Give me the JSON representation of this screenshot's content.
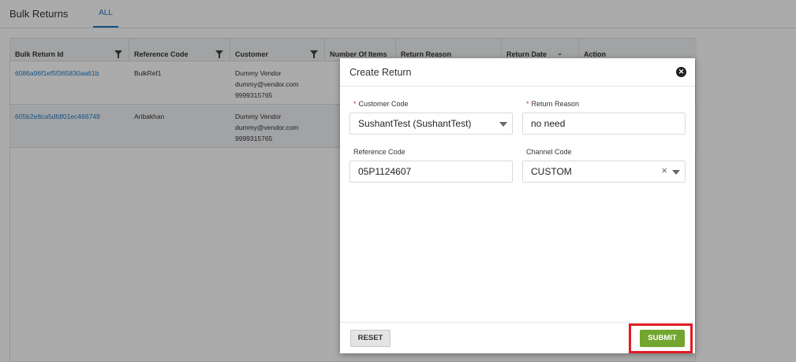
{
  "page": {
    "title": "Bulk Returns",
    "tabs": [
      {
        "label": "ALL",
        "active": true
      }
    ]
  },
  "grid": {
    "columns": [
      "Bulk Return Id",
      "Reference Code",
      "Customer",
      "Number Of Items",
      "Return Reason",
      "Return Date",
      "Action"
    ],
    "rows": [
      {
        "id": "6086a96f1ef5f365830aa61b",
        "reference": "BulkRef1",
        "customer_name": "Dummy Vendor",
        "customer_email": "dummy@vendor.com",
        "customer_phone": "9999315765"
      },
      {
        "id": "605b2e8ca5dfdf01ec466749",
        "reference": "Aribakhan",
        "customer_name": "Dummy Vendor",
        "customer_email": "dummy@vendor.com",
        "customer_phone": "9999315765"
      }
    ]
  },
  "modal": {
    "title": "Create Return",
    "close_icon": "close-icon",
    "fields": {
      "customer_code": {
        "label": "Customer Code",
        "required": true,
        "value": "SushantTest (SushantTest)"
      },
      "return_reason": {
        "label": "Return Reason",
        "required": true,
        "value": "no need"
      },
      "reference_code": {
        "label": "Reference Code",
        "required": false,
        "value": "05P1124607"
      },
      "channel_code": {
        "label": "Channel Code",
        "required": false,
        "value": "CUSTOM"
      }
    },
    "reset_label": "RESET",
    "submit_label": "SUBMIT"
  },
  "colors": {
    "accent_blue": "#1e7ac7",
    "submit_green": "#72a62e",
    "highlight_red": "#e01b24",
    "required_red": "#d9372b"
  }
}
